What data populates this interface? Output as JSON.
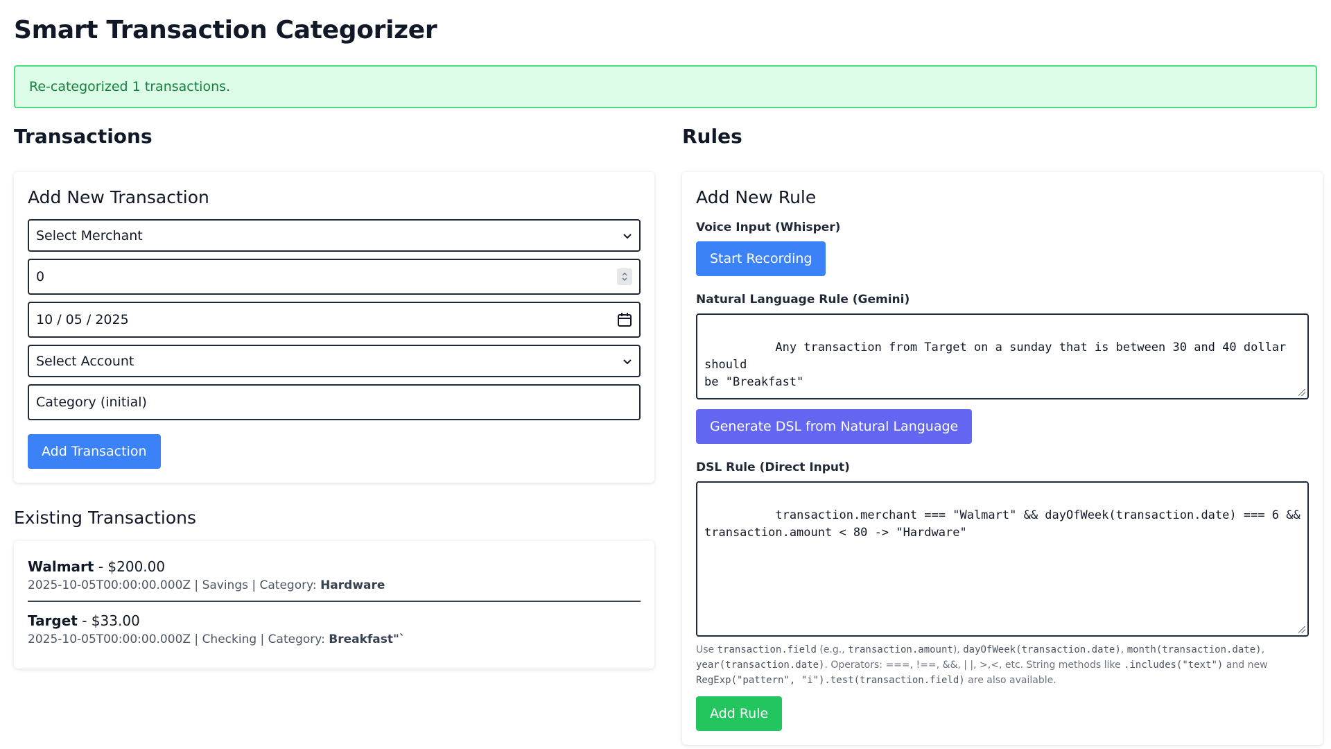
{
  "app": {
    "title": "Smart Transaction Categorizer"
  },
  "alert": {
    "message": "Re-categorized 1 transactions."
  },
  "transactions": {
    "section_title": "Transactions",
    "form": {
      "title": "Add New Transaction",
      "merchant_select": "Select Merchant",
      "amount_value": "0",
      "date_value": "10 / 05 / 2025",
      "account_select": "Select Account",
      "category_placeholder": "Category (initial)",
      "submit_label": "Add Transaction"
    },
    "existing_title": "Existing Transactions",
    "items": [
      {
        "merchant": "Walmart",
        "amount": " - $200.00",
        "meta": "2025-10-05T00:00:00.000Z | Savings | Category: ",
        "category": "Hardware"
      },
      {
        "merchant": "Target",
        "amount": " - $33.00",
        "meta": "2025-10-05T00:00:00.000Z | Checking | Category: ",
        "category": "Breakfast\"`"
      }
    ]
  },
  "rules": {
    "section_title": "Rules",
    "form": {
      "title": "Add New Rule",
      "voice_label": "Voice Input (Whisper)",
      "record_button": "Start Recording",
      "nl_label": "Natural Language Rule (Gemini)",
      "nl_value": "Any transaction from Target on a sunday that is between 30 and 40 dollar should\nbe \"Breakfast\"",
      "generate_button": "Generate DSL from Natural Language",
      "dsl_label": "DSL Rule (Direct Input)",
      "dsl_value": "transaction.merchant === \"Walmart\" && dayOfWeek(transaction.date) === 6 &&\ntransaction.amount < 80 -> \"Hardware\"",
      "help": {
        "t1": "Use ",
        "c1": "transaction.field",
        "t2": " (e.g., ",
        "c2": "transaction.amount",
        "t3": "), ",
        "c3": "dayOfWeek(transaction.date)",
        "t4": ", ",
        "c4": "month(transaction.date)",
        "t5": ",",
        "c5": "year(transaction.date)",
        "t6": ". Operators: ===, !==, &&, | |, >,<, etc. String methods like ",
        "c6": ".includes(\"text\")",
        "t7": " and new",
        "c7": "RegExp(\"pattern\", \"i\").test(transaction.field)",
        "t8": " are also available."
      },
      "add_button": "Add Rule"
    }
  },
  "colors": {
    "primary_blue": "#3b82f6",
    "indigo": "#6366f1",
    "green": "#22c55e",
    "alert_bg": "#dcfce7",
    "alert_border": "#4ade80",
    "alert_text": "#15803d"
  },
  "icons": {
    "select_chevron": "chevron-down-icon",
    "number_spinner": "spinner-icon",
    "date_picker": "calendar-icon",
    "textarea_resize": "resize-grip-icon"
  }
}
